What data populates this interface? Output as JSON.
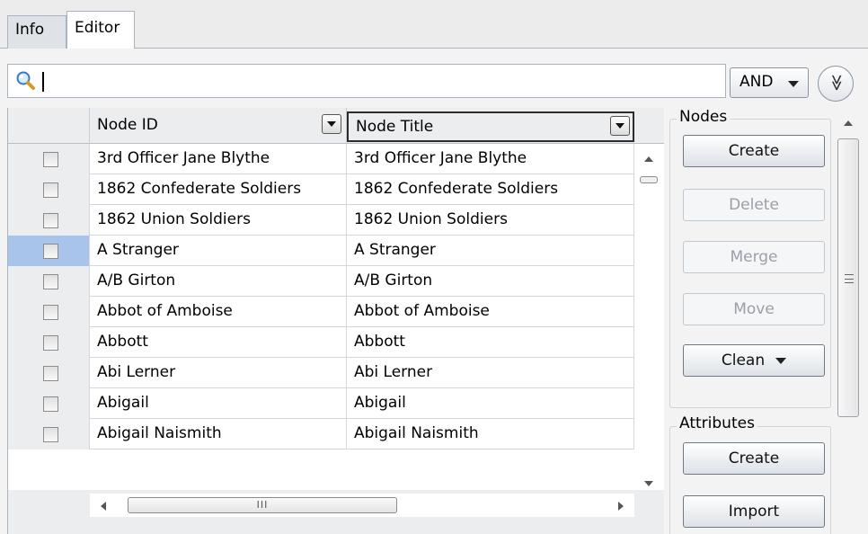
{
  "tabs": [
    {
      "label": "Info"
    },
    {
      "label": "Editor"
    }
  ],
  "search": {
    "value": "",
    "operator": "AND",
    "expand_glyph": "≫"
  },
  "table": {
    "columns": [
      "Node ID",
      "Node Title"
    ],
    "rows": [
      {
        "id": "3rd Officer Jane Blythe",
        "title": "3rd Officer Jane Blythe",
        "selected": false
      },
      {
        "id": "1862 Confederate Soldiers",
        "title": "1862 Confederate Soldiers",
        "selected": false
      },
      {
        "id": "1862 Union Soldiers",
        "title": "1862 Union Soldiers",
        "selected": false
      },
      {
        "id": "A Stranger",
        "title": "A Stranger",
        "selected": true
      },
      {
        "id": "A/B Girton",
        "title": "A/B Girton",
        "selected": false
      },
      {
        "id": "Abbot of Amboise",
        "title": "Abbot of Amboise",
        "selected": false
      },
      {
        "id": "Abbott",
        "title": "Abbott",
        "selected": false
      },
      {
        "id": "Abi Lerner",
        "title": "Abi Lerner",
        "selected": false
      },
      {
        "id": "Abigail",
        "title": "Abigail",
        "selected": false
      },
      {
        "id": "Abigail Naismith",
        "title": "Abigail Naismith",
        "selected": false
      }
    ],
    "hscroll_grip": "III"
  },
  "nodes": {
    "label": "Nodes",
    "create": "Create",
    "delete": "Delete",
    "merge": "Merge",
    "move": "Move",
    "clean": "Clean"
  },
  "attributes": {
    "label": "Attributes",
    "create": "Create",
    "import": "Import"
  }
}
